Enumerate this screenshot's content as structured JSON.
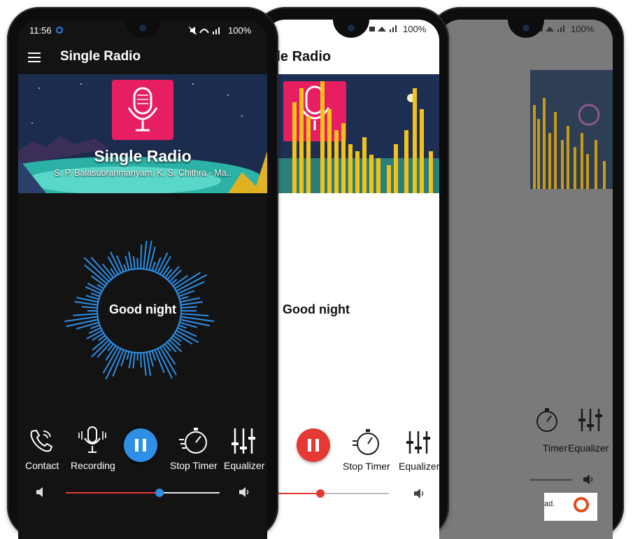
{
  "status": {
    "time": "11:56",
    "battery": "100%"
  },
  "app": {
    "title": "Single Radio",
    "menu_icon": "hamburger-menu-icon"
  },
  "banner": {
    "title": "Single Radio",
    "subtitle": "S. P. Balasubrahmanyam, K. S. Chithra - Ma..",
    "logo_icon": "microphone-icon"
  },
  "player": {
    "now_playing": "Good night",
    "volume_level": 0.61,
    "accent_colors": {
      "dark_theme": "#2f8fe6",
      "light_theme": "#e53935"
    }
  },
  "controls": {
    "contact": "Contact",
    "recording": "Recording",
    "stop_timer": "Stop Timer",
    "equalizer": "Equalizer",
    "recording_partial": "g",
    "stop_timer_partial": "Timer"
  },
  "ad": {
    "text": "ad."
  }
}
